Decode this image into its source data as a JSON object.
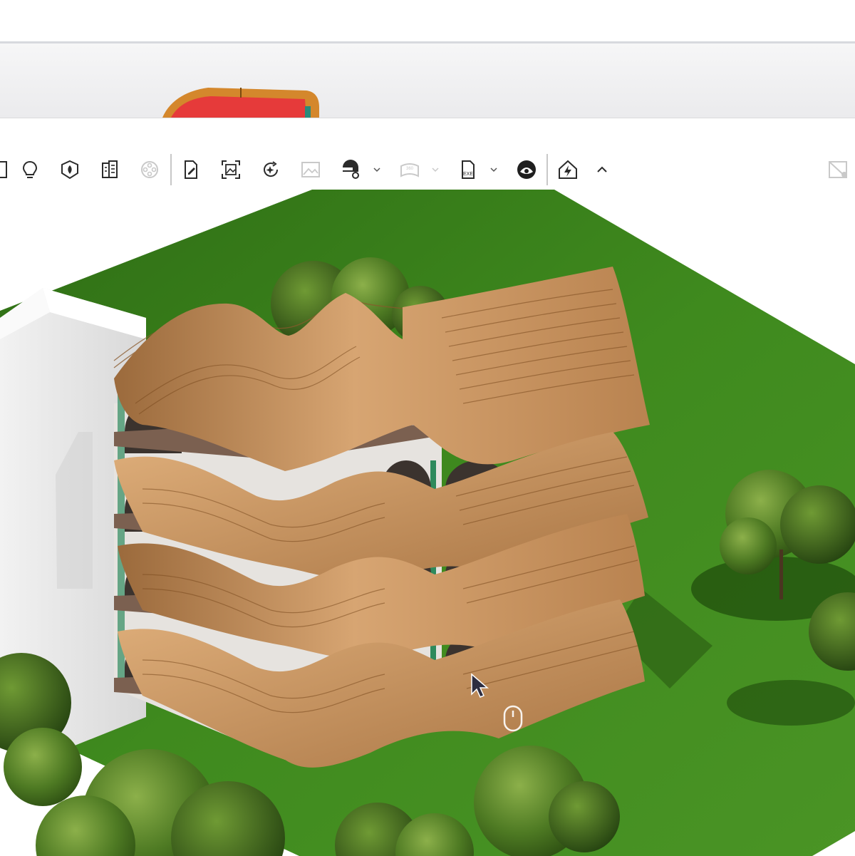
{
  "app": {
    "accent": "#2b2b2b",
    "disabled": "#c9c9c9"
  },
  "toolbar": {
    "items": [
      {
        "icon": "door-icon",
        "enabled": true
      },
      {
        "icon": "lightbulb-icon",
        "enabled": true
      },
      {
        "icon": "shield-object-icon",
        "enabled": true
      },
      {
        "icon": "building-icon",
        "enabled": true
      },
      {
        "icon": "film-reel-icon",
        "enabled": false
      },
      {
        "icon": "document-edit-icon",
        "enabled": true
      },
      {
        "icon": "screenshot-image-icon",
        "enabled": true
      },
      {
        "icon": "sparkle-refresh-icon",
        "enabled": true
      },
      {
        "icon": "image-icon",
        "enabled": false
      },
      {
        "icon": "video-settings-icon",
        "enabled": true
      },
      {
        "icon": "panorama-360-icon",
        "enabled": false,
        "label": "360"
      },
      {
        "icon": "exe-export-icon",
        "enabled": true,
        "label": "EXE"
      },
      {
        "icon": "vr-headset-icon",
        "enabled": true
      },
      {
        "icon": "house-power-icon",
        "enabled": true
      },
      {
        "icon": "chevron-up-icon",
        "enabled": true
      },
      {
        "icon": "image-off-icon",
        "enabled": false
      }
    ]
  },
  "viewport": {
    "scene": "3d-render-viewport",
    "ground_color": "#3f8a1e",
    "timber_color": "#c99562"
  }
}
